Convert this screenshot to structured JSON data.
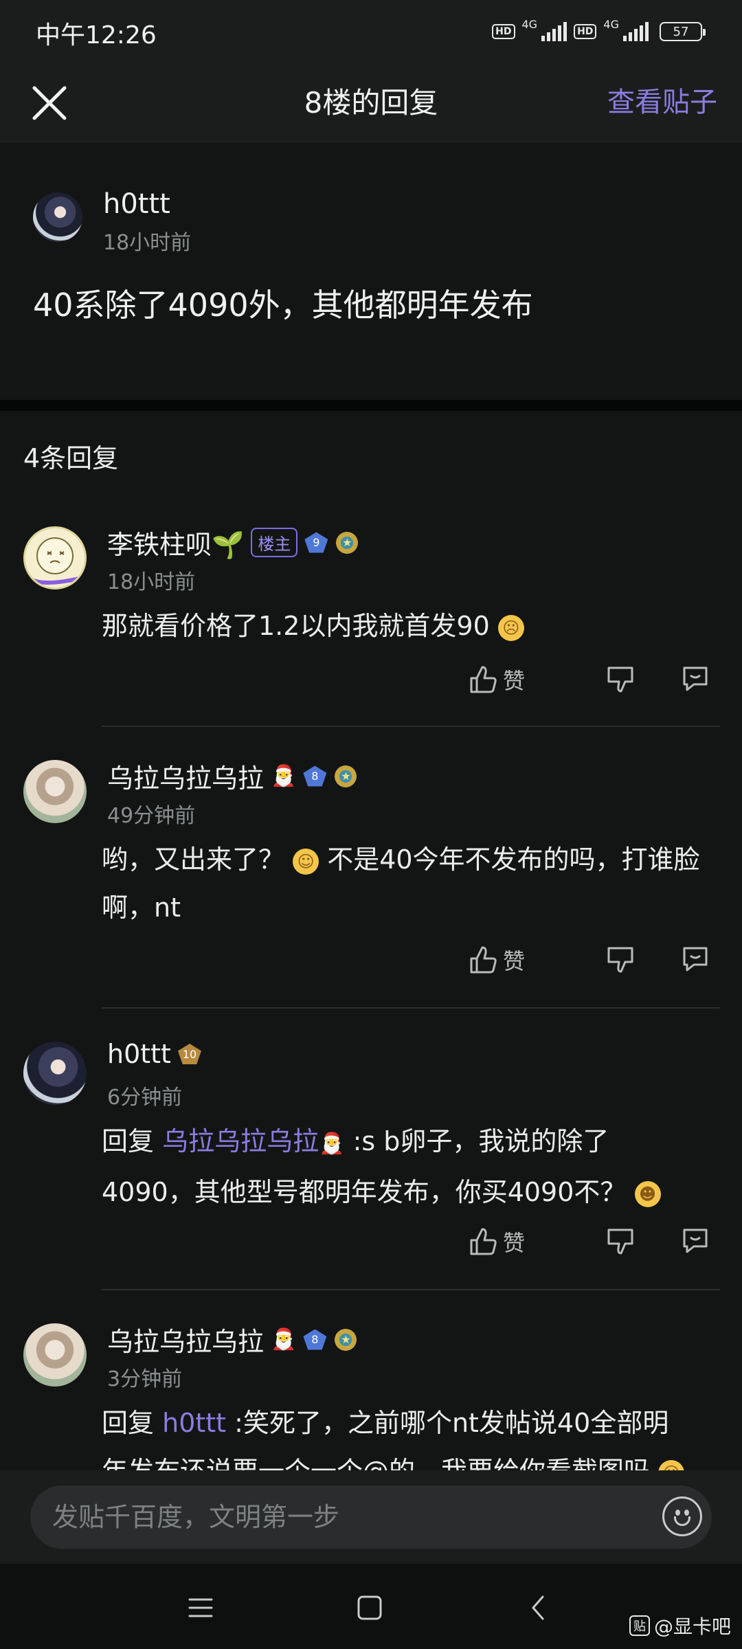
{
  "status_bar": {
    "time": "中午12:26",
    "hd1": "HD",
    "net1": "4G",
    "hd2": "HD",
    "net2": "4G",
    "battery": "57"
  },
  "header": {
    "title": "8楼的回复",
    "view_post": "查看贴子"
  },
  "main_post": {
    "author": "h0ttt",
    "time": "18小时前",
    "content": "40系除了4090外，其他都明年发布"
  },
  "replies_count": "4条回复",
  "actions": {
    "like": "赞"
  },
  "replies": [
    {
      "author": "李铁柱呗🌱",
      "host_badge": "楼主",
      "level": "9",
      "time": "18小时前",
      "text": "那就看价格了1.2以内我就首发90"
    },
    {
      "author": "乌拉乌拉乌拉",
      "level": "8",
      "time": "49分钟前",
      "text_a": "哟，又出来了？",
      "text_b": "不是40今年不发布的吗，打谁脸",
      "text_c": "啊，nt"
    },
    {
      "author": "h0ttt",
      "level": "10",
      "time": "6分钟前",
      "reply_prefix": "回复",
      "mention": "乌拉乌拉乌拉",
      "text_a": ":s b卵子，我说的除了",
      "text_b": "4090，其他型号都明年发布，你买4090不？"
    },
    {
      "author": "乌拉乌拉乌拉",
      "level": "8",
      "time": "3分钟前",
      "reply_prefix": "回复",
      "mention": "h0ttt",
      "text_a": ":笑死了，之前哪个nt发帖说40全部明",
      "text_b": "年发布还说要一个一个@的，我要给你看截图吗"
    }
  ],
  "input": {
    "placeholder": "发贴千百度，文明第一步"
  },
  "watermark": {
    "box": "贴",
    "text": "@显卡吧"
  },
  "colors": {
    "accent": "#8a7de0",
    "background": "#131515",
    "header_bg": "#1b1d1d"
  }
}
